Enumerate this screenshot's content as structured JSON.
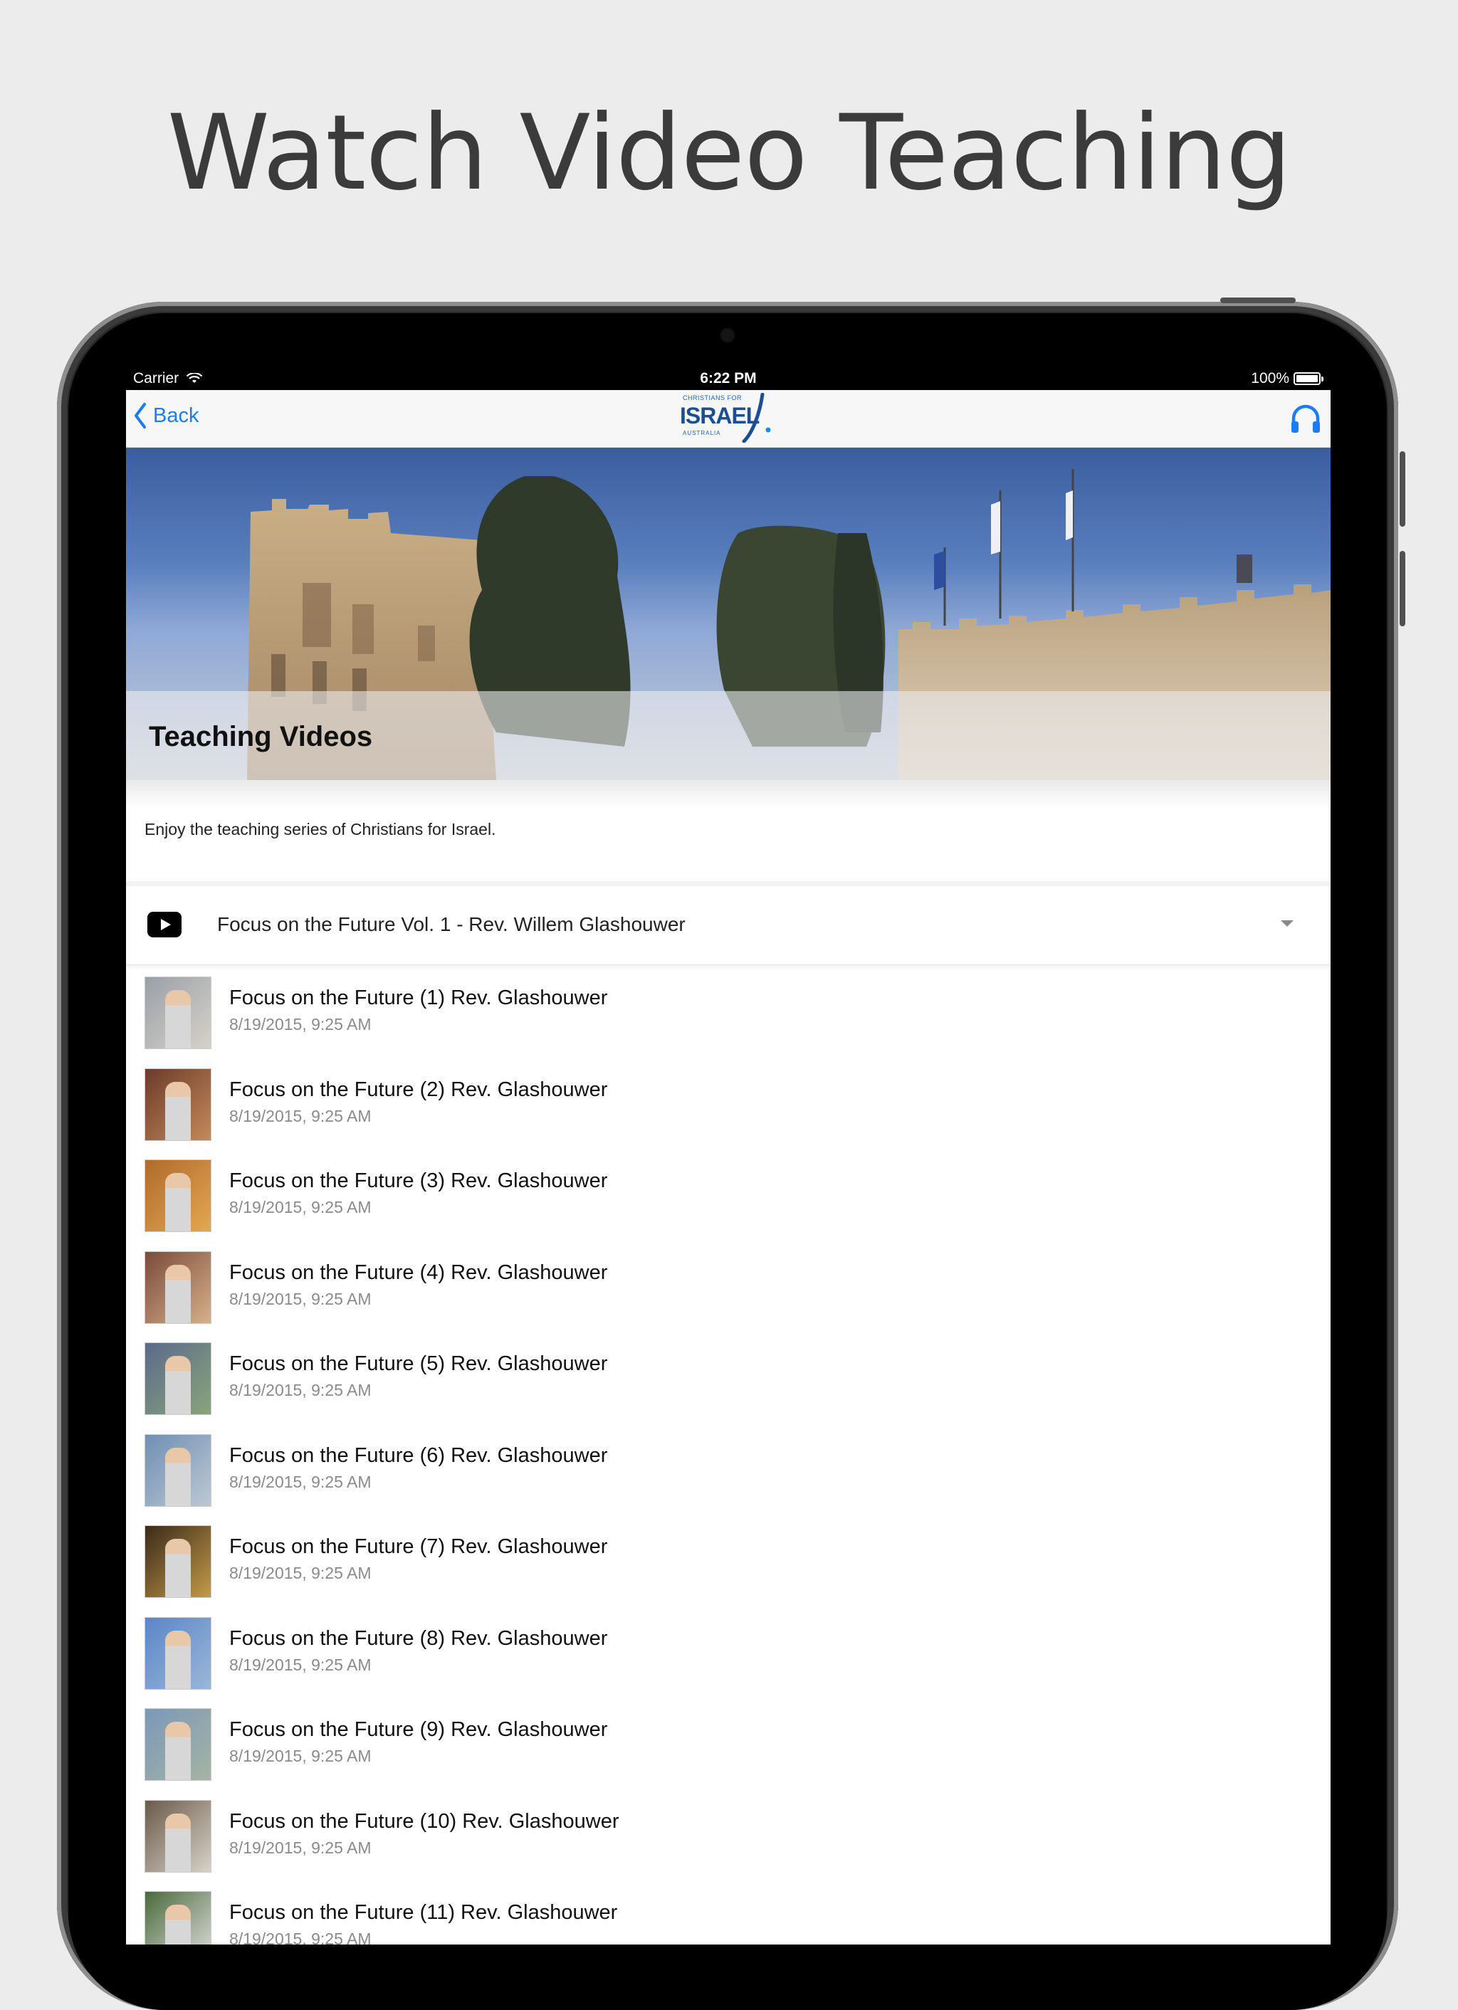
{
  "headline": "Watch Video Teaching",
  "status_bar": {
    "carrier": "Carrier",
    "time": "6:22 PM",
    "battery": "100%"
  },
  "nav": {
    "back_label": "Back",
    "logo": {
      "top": "CHRISTIANS FOR",
      "main": "ISRAEL",
      "bottom": "AUSTRALIA"
    },
    "right_icon": "headphones-icon"
  },
  "hero": {
    "title": "Teaching Videos"
  },
  "intro_text": "Enjoy the teaching series of Christians for Israel.",
  "section": {
    "icon": "youtube-play-icon",
    "title": "Focus on the Future Vol. 1 - Rev. Willem Glashouwer"
  },
  "videos": [
    {
      "title": "Focus on the Future (1) Rev. Glashouwer",
      "date": "8/19/2015, 9:25 AM"
    },
    {
      "title": "Focus on the Future (2) Rev. Glashouwer",
      "date": "8/19/2015, 9:25 AM"
    },
    {
      "title": "Focus on the Future (3) Rev. Glashouwer",
      "date": "8/19/2015, 9:25 AM"
    },
    {
      "title": "Focus on the Future (4) Rev. Glashouwer",
      "date": "8/19/2015, 9:25 AM"
    },
    {
      "title": "Focus on the Future (5) Rev. Glashouwer",
      "date": "8/19/2015, 9:25 AM"
    },
    {
      "title": "Focus on the Future (6) Rev. Glashouwer",
      "date": "8/19/2015, 9:25 AM"
    },
    {
      "title": "Focus on the Future (7) Rev. Glashouwer",
      "date": "8/19/2015, 9:25 AM"
    },
    {
      "title": "Focus on the Future (8) Rev. Glashouwer",
      "date": "8/19/2015, 9:25 AM"
    },
    {
      "title": "Focus on the Future (9) Rev. Glashouwer",
      "date": "8/19/2015, 9:25 AM"
    },
    {
      "title": "Focus on the Future (10) Rev. Glashouwer",
      "date": "8/19/2015, 9:25 AM"
    },
    {
      "title": "Focus on the Future (11) Rev. Glashouwer",
      "date": "8/19/2015, 9:25 AM"
    }
  ],
  "colors": {
    "accent": "#1c7cf4",
    "background": "#ececec",
    "logo_blue": "#1c4f92"
  }
}
